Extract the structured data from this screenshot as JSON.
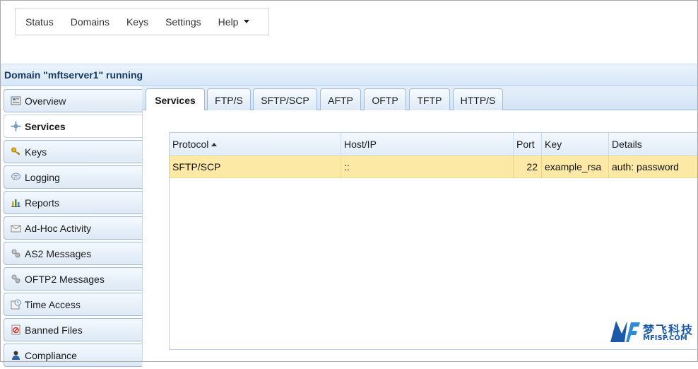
{
  "menu": {
    "items": [
      "Status",
      "Domains",
      "Keys",
      "Settings"
    ],
    "help": "Help"
  },
  "domain_header": "Domain \"mftserver1\" running",
  "sidebar": {
    "items": [
      {
        "label": "Overview",
        "icon": "overview-icon"
      },
      {
        "label": "Services",
        "icon": "services-icon"
      },
      {
        "label": "Keys",
        "icon": "keys-icon"
      },
      {
        "label": "Logging",
        "icon": "logging-icon"
      },
      {
        "label": "Reports",
        "icon": "reports-icon"
      },
      {
        "label": "Ad-Hoc Activity",
        "icon": "adhoc-icon"
      },
      {
        "label": "AS2 Messages",
        "icon": "as2-icon"
      },
      {
        "label": "OFTP2 Messages",
        "icon": "oftp2-icon"
      },
      {
        "label": "Time Access",
        "icon": "time-access-icon"
      },
      {
        "label": "Banned Files",
        "icon": "banned-files-icon"
      },
      {
        "label": "Compliance",
        "icon": "compliance-icon"
      }
    ],
    "active_index": 1
  },
  "tabs": [
    "Services",
    "FTP/S",
    "SFTP/SCP",
    "AFTP",
    "OFTP",
    "TFTP",
    "HTTP/S"
  ],
  "active_tab": 0,
  "grid": {
    "columns": [
      "Protocol",
      "Host/IP",
      "Port",
      "Key",
      "Details"
    ],
    "sort_column": "Protocol",
    "rows": [
      {
        "protocol": "SFTP/SCP",
        "host": "::",
        "port": "22",
        "key": "example_rsa",
        "details": "auth: password"
      }
    ]
  },
  "watermark": {
    "cn": "梦飞科技",
    "en": "MFISP.COM"
  },
  "colors": {
    "accent": "#d7e7f8",
    "selected_row": "#fbe9a5",
    "header_text": "#15395e"
  }
}
